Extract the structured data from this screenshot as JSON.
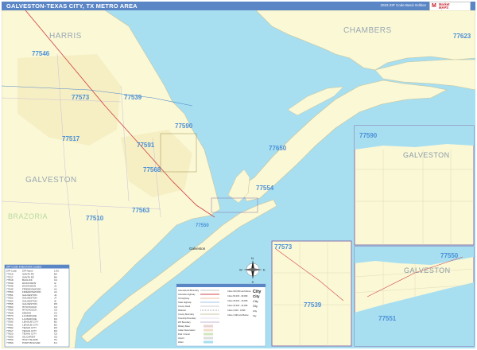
{
  "header": {
    "title": "GALVESTON-TEXAS CITY, TX METRO AREA",
    "edition": "2023 ZIP Code Basic Edition",
    "logo_mark": "M",
    "logo_line1": "Market",
    "logo_line2": "MAPS",
    "logo_line3": "Since 1985"
  },
  "colors": {
    "water": "#a7dff1",
    "land": "#fbf8d6",
    "urban": "#f6efc4",
    "title_bar": "#5b86c5",
    "zip_label": "#4a8fd6",
    "highway": "#d24a4a",
    "inset_border": "#8a6fa8"
  },
  "map": {
    "counties": {
      "harris": "HARRIS",
      "chambers": "CHAMBERS",
      "galveston": "GALVESTON",
      "brazoria": "BRAZORIA"
    },
    "zips": {
      "z77546": "77546",
      "z77573": "77573",
      "z77539": "77539",
      "z77590": "77590",
      "z77591": "77591",
      "z77517": "77517",
      "z77568": "77568",
      "z77563": "77563",
      "z77510": "77510",
      "z77554": "77554",
      "z77650": "77650",
      "z77623": "77623",
      "z77550": "77550"
    },
    "city_label": "Galveston",
    "insets": {
      "east_zip": "77590",
      "east_county": "GALVESTON",
      "mid_zip_top": "77573",
      "mid_zip_bottom": "77539",
      "south_zip_top": "77550",
      "south_zip_bottom": "77551",
      "south_county": "GALVESTON"
    }
  },
  "compass": {
    "n": "N",
    "s": "S",
    "e": "E",
    "w": "W"
  },
  "legend": {
    "items": [
      "International Boundary",
      "Interstate Highway",
      "US Highway",
      "State Highway",
      "County Road",
      "Railroad",
      "County Boundary",
      "Township Boundary",
      "ZIP Boundary",
      "Military Base",
      "Indian Reservation",
      "Park / Forest",
      "Airport",
      "Water"
    ],
    "city_items": [
      "Cities 100,000 and Above",
      "Cities 50,000 - 99,999",
      "Cities 25,000 - 49,999",
      "Cities 10,000 - 24,999",
      "Cities 2,000 - 9,999",
      "Cities 1,999 and Below"
    ],
    "city_text_samples": [
      "City",
      "City",
      "City",
      "City",
      "City",
      "City"
    ]
  },
  "zip_table": {
    "title": "ZIP Code Index/Grid Locator",
    "columns": [
      "ZIP Code",
      "ZIP Name",
      "LOC"
    ],
    "rows": [
      [
        "77510",
        "SANTA FE",
        "B4"
      ],
      [
        "77517",
        "SANTA FE",
        "B4"
      ],
      [
        "77518",
        "BACLIFF",
        "C2"
      ],
      [
        "77539",
        "DICKINSON",
        "I2"
      ],
      [
        "77546",
        "DICKINSON",
        "J1"
      ],
      [
        "77549",
        "FRIENDSWOOD",
        "A1"
      ],
      [
        "77550",
        "FRIENDSWOOD",
        "A1"
      ],
      [
        "77551",
        "GALVESTON",
        "J4"
      ],
      [
        "77552",
        "GALVESTON",
        "J7"
      ],
      [
        "77554",
        "GALVESTON",
        "I8"
      ],
      [
        "77555",
        "GALVESTON",
        "D5"
      ],
      [
        "77563",
        "HITCHCOCK",
        "C4"
      ],
      [
        "77565",
        "HITCHCOCK",
        "C5"
      ],
      [
        "77568",
        "KEMAH",
        "C2"
      ],
      [
        "77573",
        "LA MARQUE",
        "C4"
      ],
      [
        "77574",
        "LA MARQUE",
        "D4"
      ],
      [
        "77590",
        "LEAGUE CITY",
        "B2"
      ],
      [
        "77591",
        "LEAGUE CITY",
        "B2"
      ],
      [
        "77592",
        "TEXAS CITY",
        "D3"
      ],
      [
        "77617",
        "TEXAS CITY",
        "D3"
      ],
      [
        "77623",
        "TEXAS CITY",
        "C3"
      ],
      [
        "77650",
        "GILCHRIST",
        "G2"
      ],
      [
        "77650",
        "HIGH ISLAND",
        "H1"
      ],
      [
        "77650",
        "PORT BOLIVAR",
        "F4"
      ]
    ]
  }
}
